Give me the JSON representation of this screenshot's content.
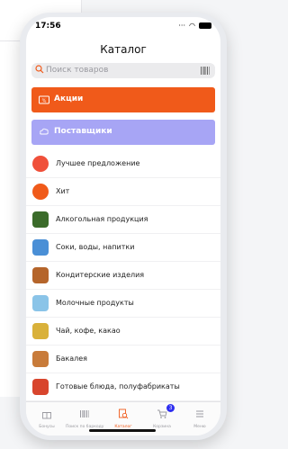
{
  "status": {
    "time": "17:56"
  },
  "header": {
    "title": "Каталог"
  },
  "search": {
    "placeholder": "Поиск товаров"
  },
  "banners": [
    {
      "label": "Акции",
      "color": "#f05a1a",
      "icon": "sale-tag-icon"
    },
    {
      "label": "Поставщики",
      "color": "#a7a5f5",
      "icon": "truck-icon"
    }
  ],
  "categories": [
    {
      "label": "Лучшее предложение",
      "icon": "percent-icon",
      "color": "#f0503a"
    },
    {
      "label": "Хит",
      "icon": "hit-badge-icon",
      "color": "#f05a1a"
    },
    {
      "label": "Алкогольная продукция",
      "icon": "bottles-icon",
      "color": "#3b6b2a"
    },
    {
      "label": "Соки, воды, напитки",
      "icon": "juice-icon",
      "color": "#4a8fd6"
    },
    {
      "label": "Кондитерские изделия",
      "icon": "cake-icon",
      "color": "#b5652b"
    },
    {
      "label": "Молочные продукты",
      "icon": "milk-icon",
      "color": "#8ac4e8"
    },
    {
      "label": "Чай, кофе, какао",
      "icon": "tea-icon",
      "color": "#d9b13a"
    },
    {
      "label": "Бакалея",
      "icon": "grocery-icon",
      "color": "#c87b3a"
    },
    {
      "label": "Готовые блюда, полуфабрикаты",
      "icon": "ready-meal-icon",
      "color": "#d8452d"
    }
  ],
  "tabbar": {
    "tabs": [
      {
        "label": "Бонусы",
        "icon": "gift-icon"
      },
      {
        "label": "Поиск по баркоду",
        "icon": "barcode-icon"
      },
      {
        "label": "Каталог",
        "icon": "catalog-search-icon"
      },
      {
        "label": "Корзина",
        "icon": "cart-icon"
      },
      {
        "label": "Меню",
        "icon": "menu-icon"
      }
    ],
    "active_index": 2,
    "cart_badge": "3"
  },
  "colors": {
    "accent": "#f05a1a",
    "supplier": "#a7a5f5",
    "badge": "#2e2ef0"
  }
}
